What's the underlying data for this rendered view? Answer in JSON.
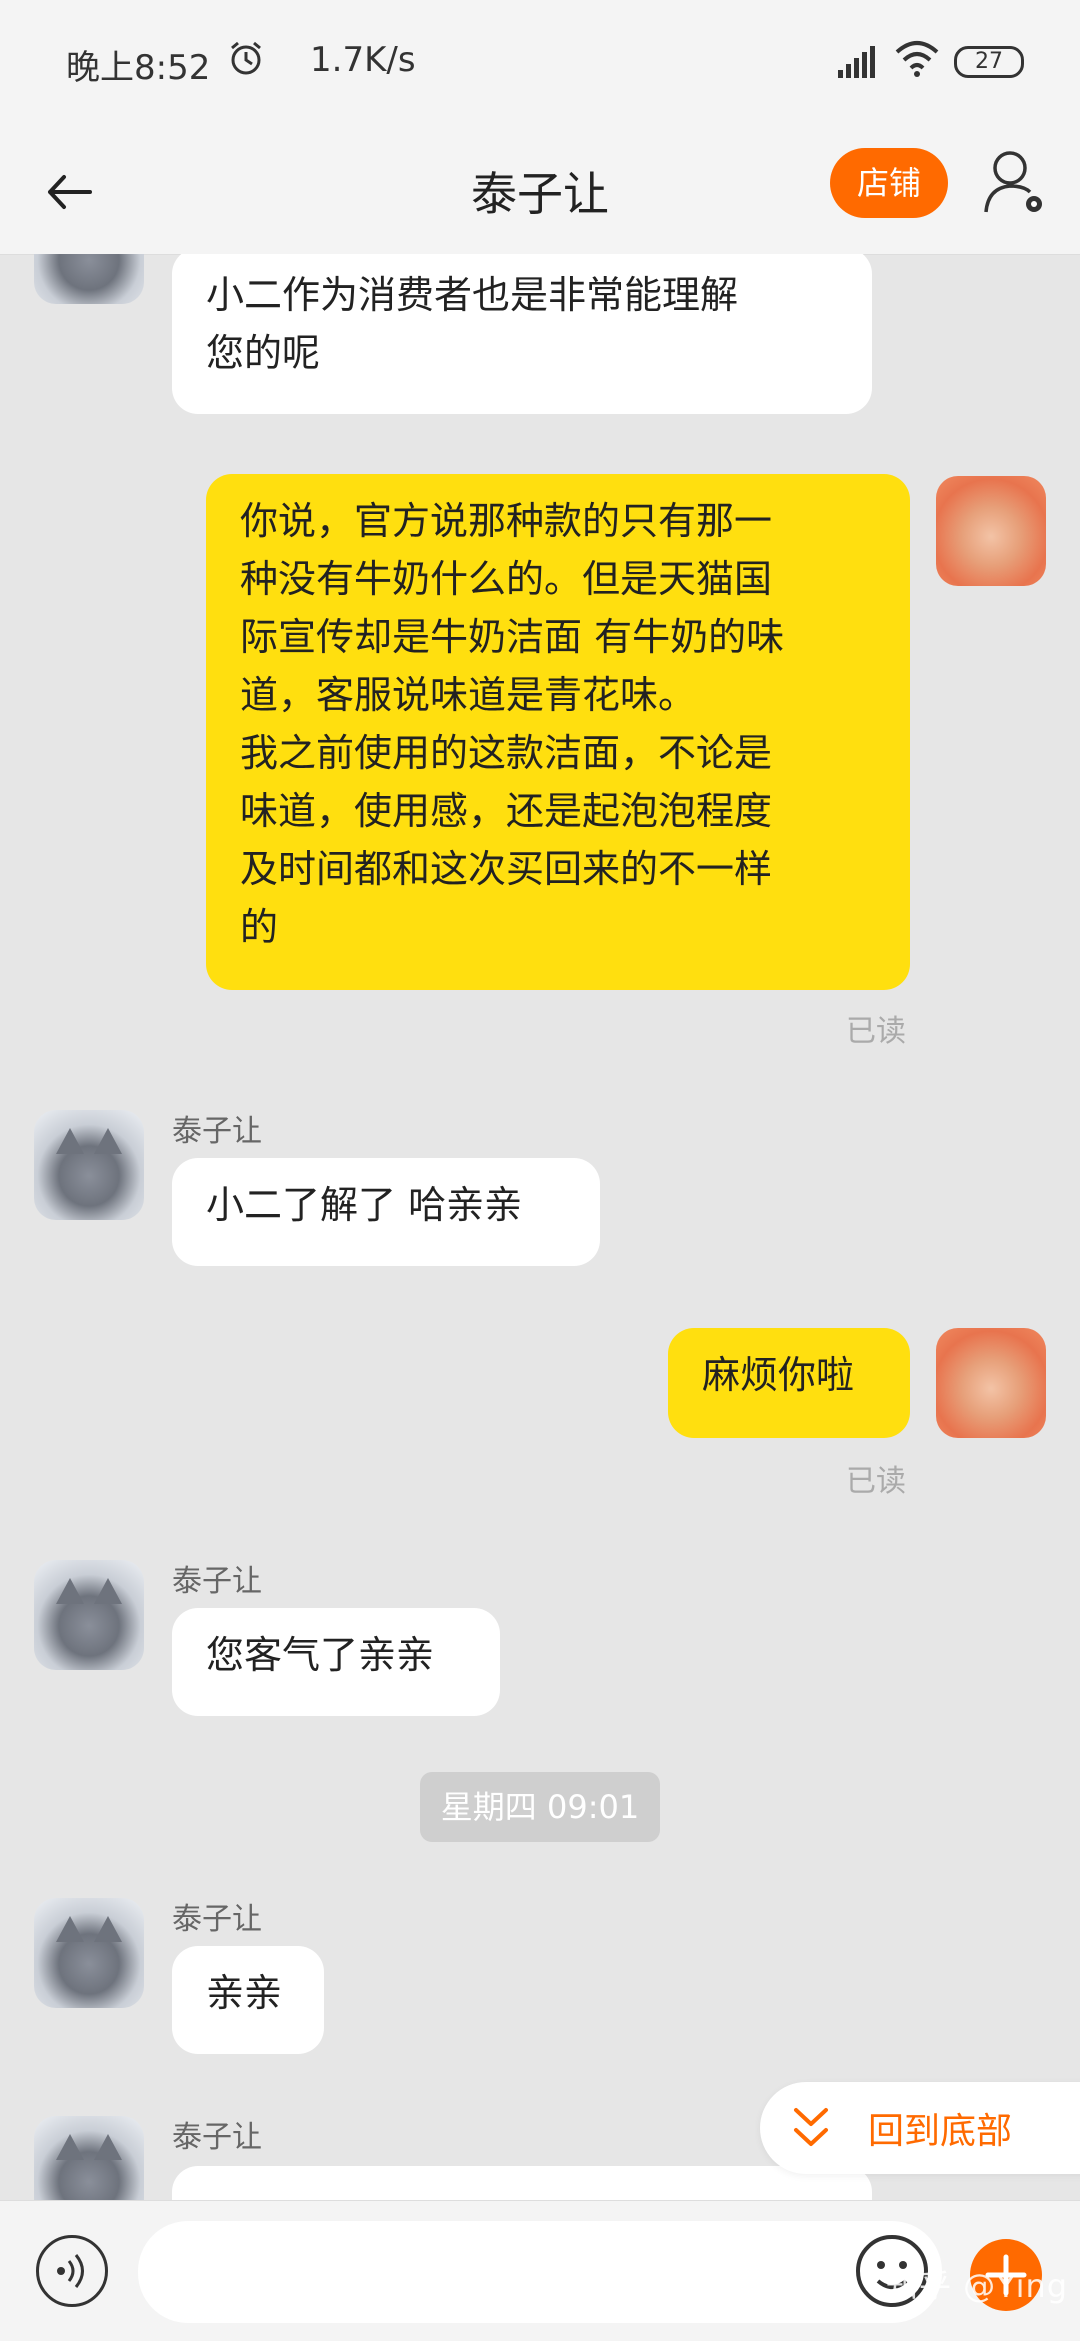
{
  "status_bar": {
    "time": "晚上8:52",
    "speed": "1.7K/s",
    "battery": "27",
    "alarm_icon": "alarm-icon",
    "signal_icon": "signal-icon",
    "wifi_icon": "wifi-icon"
  },
  "header": {
    "title": "泰子让",
    "shop_label": "店铺",
    "back_icon": "arrow-left-icon",
    "user_icon": "user-settings-icon"
  },
  "messages": [
    {
      "from": "them",
      "sender": "",
      "text": "小二作为消费者也是非常能理解\n您的呢"
    },
    {
      "from": "me",
      "text": "你说，官方说那种款的只有那一\n种没有牛奶什么的。但是天猫国\n际宣传却是牛奶洁面 有牛奶的味\n道，客服说味道是青花味。\n我之前使用的这款洁面，不论是\n味道，使用感，还是起泡泡程度\n及时间都和这次买回来的不一样\n的",
      "status": "已读"
    },
    {
      "from": "them",
      "sender": "泰子让",
      "text": "小二了解了 哈亲亲"
    },
    {
      "from": "me",
      "text": "麻烦你啦",
      "status": "已读"
    },
    {
      "from": "them",
      "sender": "泰子让",
      "text": "您客气了亲亲"
    },
    {
      "time_divider": "星期四 09:01"
    },
    {
      "from": "them",
      "sender": "泰子让",
      "text": "亲亲"
    },
    {
      "from": "them",
      "sender": "泰子让",
      "text": ""
    }
  ],
  "scroll_to_bottom": {
    "label": "回到底部",
    "icon": "double-chevron-down-icon"
  },
  "input": {
    "placeholder": "",
    "voice_icon": "voice-icon",
    "emoji_icon": "emoji-icon",
    "plus_icon": "plus-icon"
  },
  "watermark": "知乎 @Ying",
  "colors": {
    "accent": "#ff6a00",
    "my_bubble": "#ffdf0f",
    "their_bubble": "#ffffff",
    "background": "#e6e6e6"
  }
}
